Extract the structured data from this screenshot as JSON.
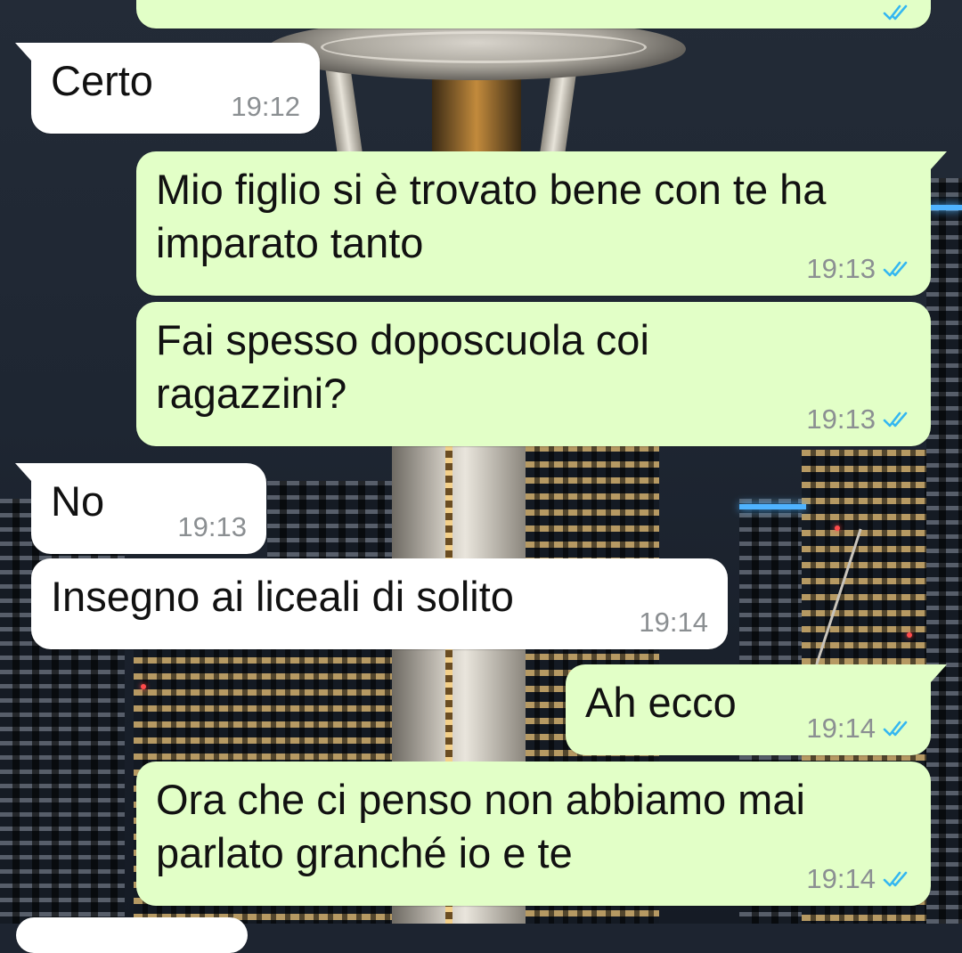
{
  "wallpaper": {
    "description_icon": "city-night-wallpaper"
  },
  "status_icons": {
    "read": "double-check-icon",
    "read_color": "#34b7f1"
  },
  "messages": [
    {
      "direction": "out",
      "text": "",
      "time": ""
    },
    {
      "direction": "in",
      "text": "Certo",
      "time": "19:12"
    },
    {
      "direction": "out",
      "lines": [
        "Mio figlio si è trovato bene con te ha",
        "imparato tanto"
      ],
      "time": "19:13",
      "status": "read"
    },
    {
      "direction": "out",
      "lines": [
        "Fai spesso doposcuola coi",
        "ragazzini?"
      ],
      "time": "19:13",
      "status": "read"
    },
    {
      "direction": "in",
      "text": "No",
      "time": "19:13"
    },
    {
      "direction": "in",
      "text": "Insegno ai liceali di solito",
      "time": "19:14"
    },
    {
      "direction": "out",
      "text": "Ah ecco",
      "time": "19:14",
      "status": "read"
    },
    {
      "direction": "out",
      "lines": [
        "Ora che ci penso non abbiamo mai",
        "parlato granché io e te"
      ],
      "time": "19:14",
      "status": "read"
    }
  ],
  "colors": {
    "outgoing_bubble": "#e2ffc7",
    "incoming_bubble": "#ffffff",
    "timestamp": "#8b8f92"
  }
}
